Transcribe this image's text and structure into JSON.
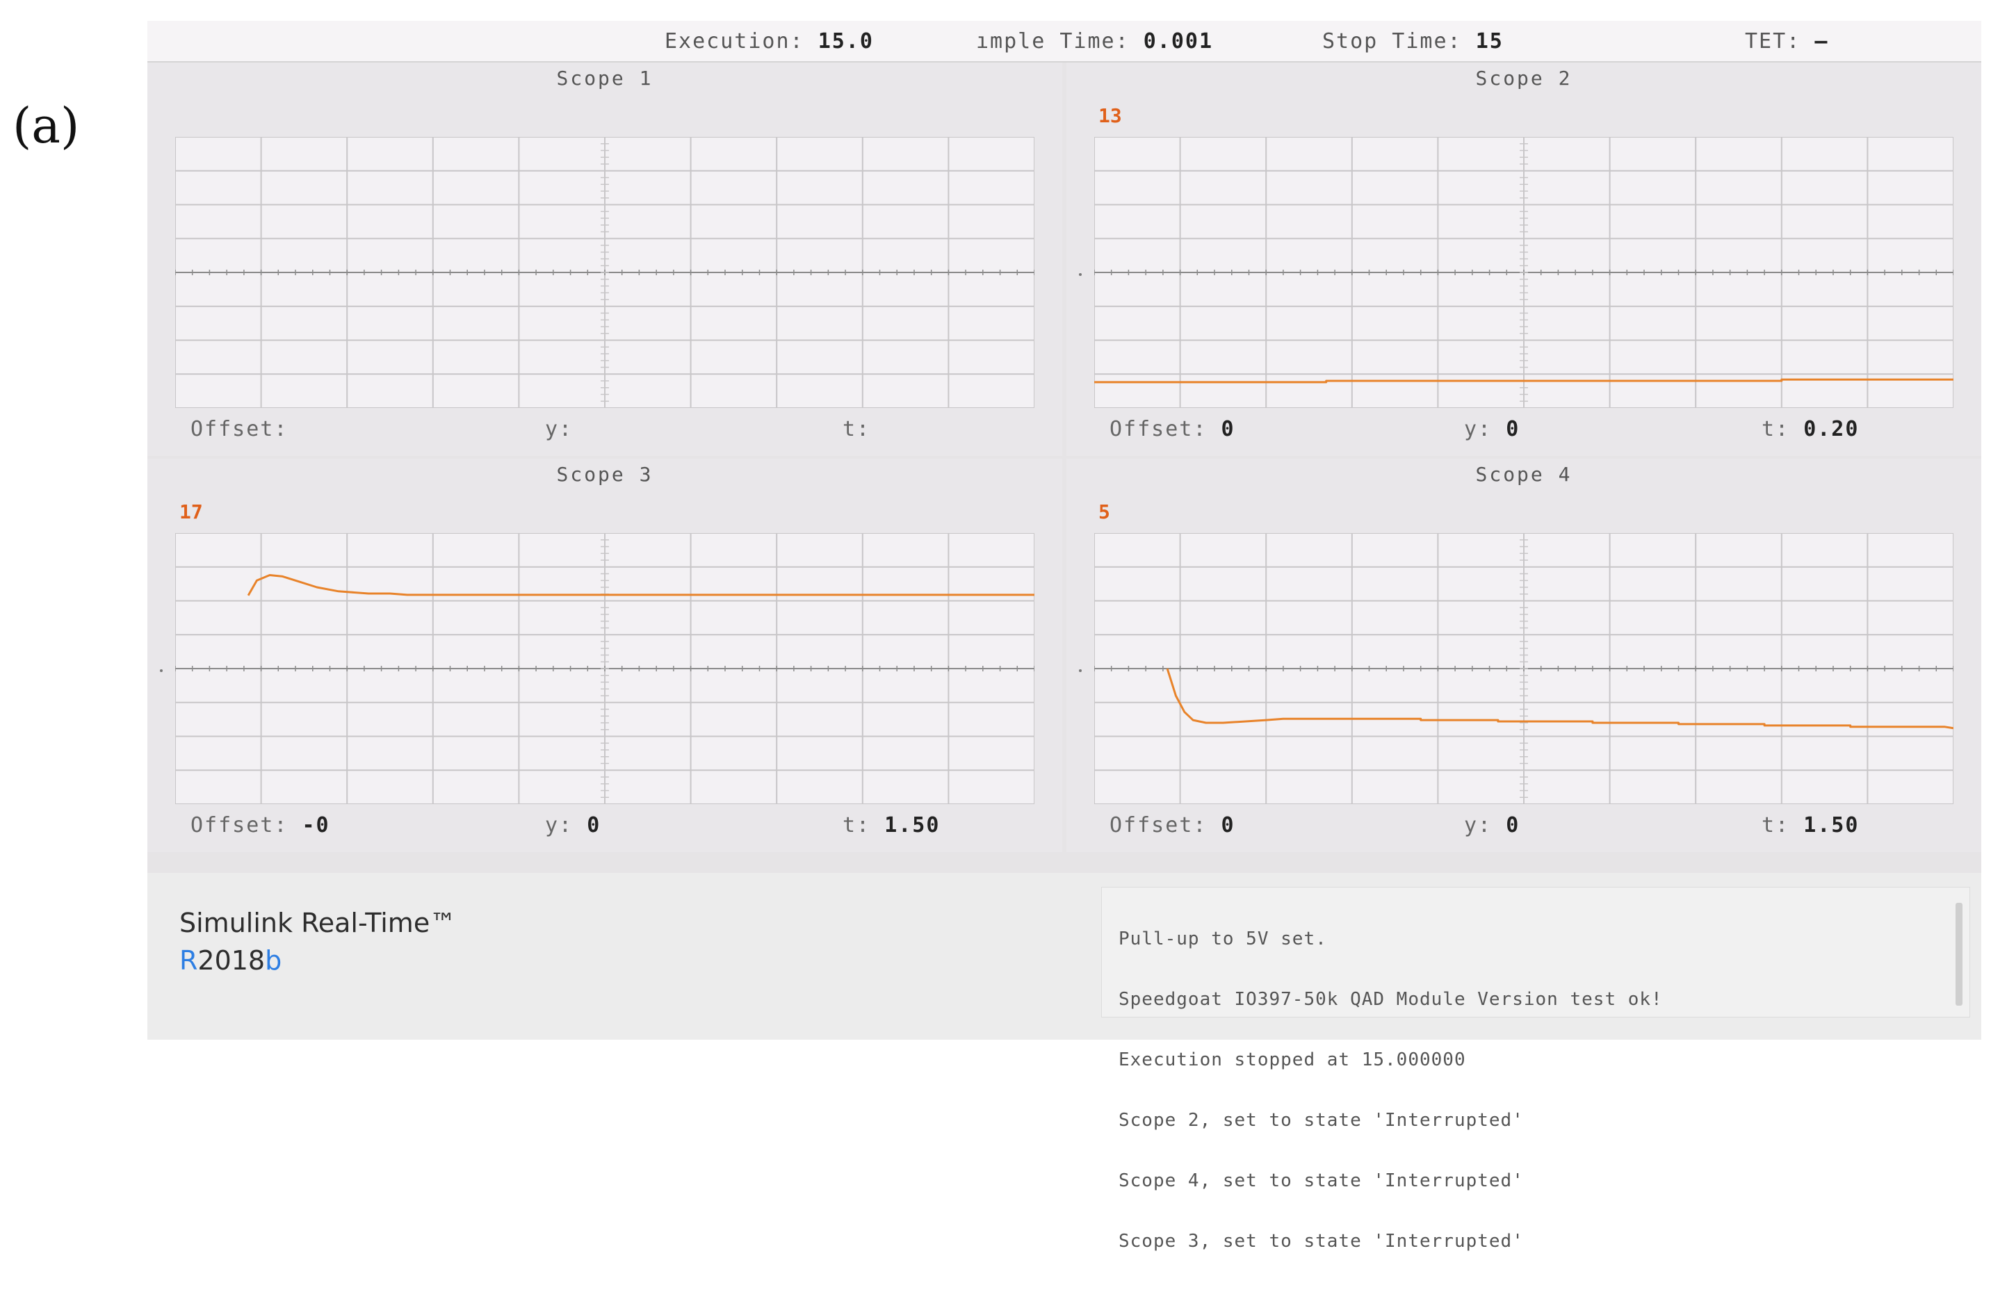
{
  "figure_label": "(a)",
  "status": {
    "execution_label": "Execution:",
    "execution_value": "15.0",
    "sample_label": "ımple Time:",
    "sample_value": "0.001",
    "stop_label": "Stop Time:",
    "stop_value": "15",
    "tet_label": "TET:",
    "tet_value": "–"
  },
  "scopes": [
    {
      "title": "Scope 1",
      "range": "",
      "offset_label": "Offset:",
      "offset": "",
      "y_label": "y:",
      "y": "",
      "t_label": "t:",
      "t": ""
    },
    {
      "title": "Scope 2",
      "range": "13",
      "offset_label": "Offset:",
      "offset": "0",
      "y_label": "y:",
      "y": "0",
      "t_label": "t:",
      "t": "0.20"
    },
    {
      "title": "Scope 3",
      "range": "17",
      "offset_label": "Offset:",
      "offset": "-0",
      "y_label": "y:",
      "y": "0",
      "t_label": "t:",
      "t": "1.50"
    },
    {
      "title": "Scope 4",
      "range": "5",
      "offset_label": "Offset:",
      "offset": "0",
      "y_label": "y:",
      "y": "0",
      "t_label": "t:",
      "t": "1.50"
    }
  ],
  "traces": {
    "color": "#e8832a",
    "grid_color": "#c8c6c8",
    "axis_color": "#8a8a8a",
    "plot_bg": "#f3f1f4"
  },
  "brand": {
    "name": "Simulink Real-Time™",
    "version_prefix": "R",
    "version_year": "2018",
    "version_suffix": "b"
  },
  "log": [
    "Pull-up to 5V set.",
    "Speedgoat IO397-50k QAD Module Version test ok!",
    "Execution stopped at 15.000000",
    "Scope 2, set to state 'Interrupted'",
    "Scope 4, set to state 'Interrupted'",
    "Scope 3, set to state 'Interrupted'"
  ]
}
